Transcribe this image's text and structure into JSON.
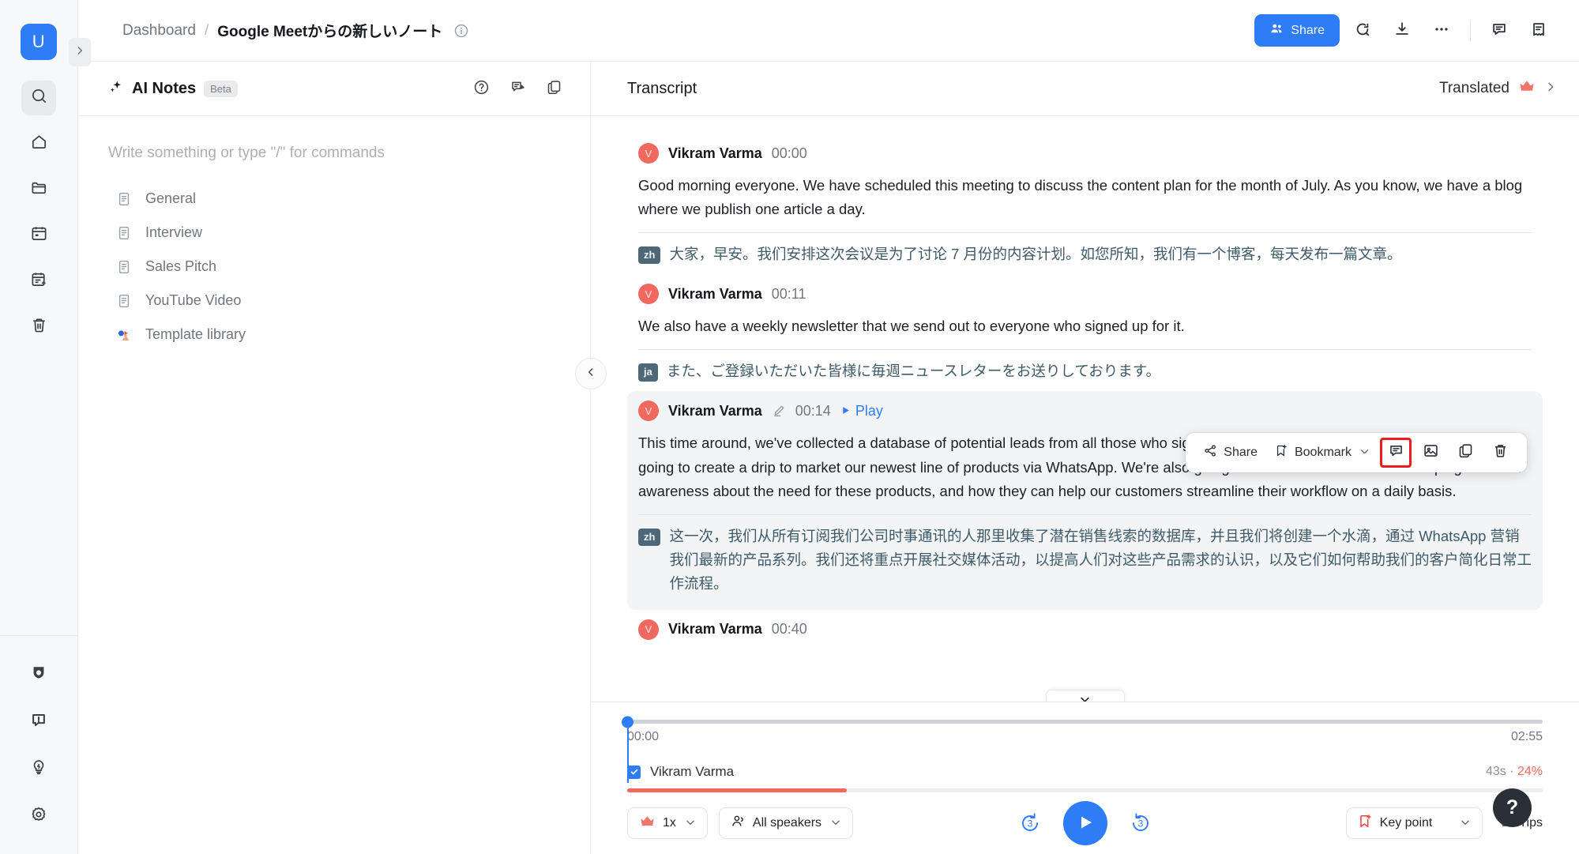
{
  "brand": {
    "logo_letter": "U",
    "accent": "#2e7cf6",
    "danger": "#f0685e"
  },
  "topbar": {
    "breadcrumb_root": "Dashboard",
    "breadcrumb_sep": "/",
    "breadcrumb_current": "Google Meetからの新しいノート",
    "share_label": "Share",
    "icons": [
      "search-icon",
      "download-icon",
      "more-options-icon",
      "comment-icon",
      "notes-icon"
    ]
  },
  "rail": {
    "items": [
      "search-icon",
      "home-icon",
      "folder-icon",
      "calendar-icon",
      "calendar-note-icon",
      "trash-icon"
    ],
    "bottom_items": [
      "shield-icon",
      "announcement-icon",
      "idea-icon",
      "settings-icon"
    ]
  },
  "notes": {
    "title": "AI Notes",
    "badge": "Beta",
    "placeholder": "Write something or type \"/\" for commands",
    "templates": [
      {
        "label": "General",
        "icon": "document-icon"
      },
      {
        "label": "Interview",
        "icon": "document-icon"
      },
      {
        "label": "Sales Pitch",
        "icon": "document-icon"
      },
      {
        "label": "YouTube Video",
        "icon": "document-icon"
      },
      {
        "label": "Template library",
        "icon": "template-library-icon"
      }
    ],
    "head_icons": [
      "help-icon",
      "feedback-icon",
      "copy-icon"
    ]
  },
  "transcript": {
    "title": "Transcript",
    "translated_label": "Translated",
    "entries": [
      {
        "speaker": "Vikram Varma",
        "avatar_letter": "V",
        "time": "00:00",
        "text": "Good morning everyone. We have scheduled this meeting to discuss the content plan for the month of July. As you know, we have a blog where we publish one article a day.",
        "lang": "zh",
        "translation": "大家，早安。我们安排这次会议是为了讨论 7 月份的内容计划。如您所知，我们有一个博客，每天发布一篇文章。"
      },
      {
        "speaker": "Vikram Varma",
        "avatar_letter": "V",
        "time": "00:11",
        "text": "We also have a weekly newsletter that we send out to everyone who signed up for it.",
        "lang": "ja",
        "translation": "また、ご登録いただいた皆様に毎週ニュースレターをお送りしております。"
      },
      {
        "speaker": "Vikram Varma",
        "avatar_letter": "V",
        "time": "00:14",
        "play_label": "Play",
        "text": "This time around, we've collected a database of potential leads from all those who signed up for our company's newsletter, and we're going to create a drip to market our newest line of products via WhatsApp. We're also going to focus on a social media campaign to build awareness about the need for these products, and how they can help our customers streamline their workflow on a daily basis.",
        "lang": "zh",
        "translation": "这一次，我们从所有订阅我们公司时事通讯的人那里收集了潜在销售线索的数据库，并且我们将创建一个水滴，通过 WhatsApp 营销我们最新的产品系列。我们还将重点开展社交媒体活动，以提高人们对这些产品需求的认识，以及它们如何帮助我们的客户简化日常工作流程。"
      },
      {
        "speaker": "Vikram Varma",
        "avatar_letter": "V",
        "time": "00:40",
        "text": "",
        "lang": "",
        "translation": ""
      }
    ]
  },
  "action_toolbar": {
    "share_label": "Share",
    "bookmark_label": "Bookmark",
    "icons": [
      "comment-icon",
      "screenshot-icon",
      "copy-icon",
      "delete-icon"
    ],
    "selected_icon": "comment-icon"
  },
  "player": {
    "current_time": "00:00",
    "total_time": "02:55",
    "speaker_name": "Vikram Varma",
    "speaker_duration": "43s",
    "speaker_separator": " · ",
    "speaker_percent": "24%",
    "speed_label": "1x",
    "speakers_filter": "All speakers",
    "skip_back": "3",
    "skip_forward": "3",
    "key_point_label": "Key point",
    "tips_label": "Tips",
    "help_label": "?"
  }
}
